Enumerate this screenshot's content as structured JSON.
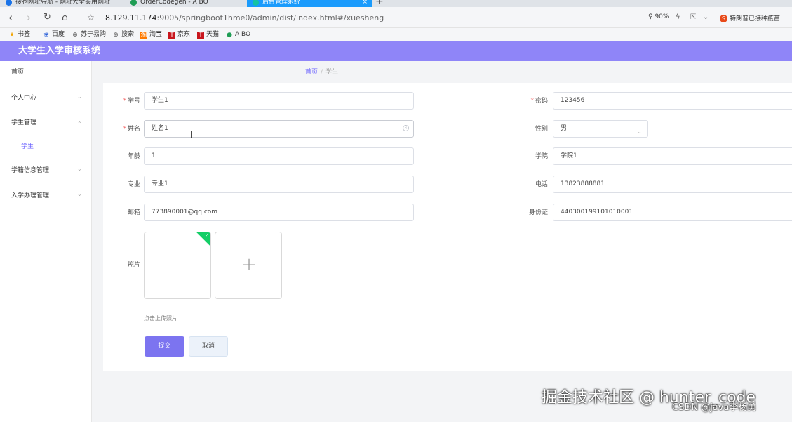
{
  "browser": {
    "tabs": [
      {
        "label": "搜狗网址导航 - 网址大全实用网址",
        "color": "#1a73e8"
      },
      {
        "label": "OrderCodegen - A BO",
        "color": "#1f9d55"
      },
      {
        "label": "后台管理系统",
        "color": "#16c2a3"
      }
    ],
    "new_tab": "+",
    "close": "×",
    "nav": {
      "back": "‹",
      "forward": "›",
      "reload": "↻",
      "home": "⌂",
      "star": "☆"
    },
    "url_host": "8.129.11.174",
    "url_rest": ":9005/springboot1hme0/admin/dist/index.html#/xuesheng",
    "zoom": "90%",
    "news": "特朗普已接种疫苗",
    "news_icon": "S",
    "bookmarks": [
      "书签",
      "百度",
      "苏宁易购",
      "搜索",
      "淘宝",
      "京东",
      "天猫",
      "A BO"
    ]
  },
  "app": {
    "title": "大学生入学审核系统"
  },
  "sidebar": {
    "items": [
      {
        "label": "首页",
        "chevron": ""
      },
      {
        "label": "个人中心",
        "chevron": "⌄"
      },
      {
        "label": "学生管理",
        "chevron": "⌃"
      },
      {
        "label": "学籍信息管理",
        "chevron": "⌄"
      },
      {
        "label": "入学办理管理",
        "chevron": "⌄"
      }
    ],
    "sub_item": "学生"
  },
  "breadcrumb": {
    "home": "首页",
    "separator": "/",
    "current": "学生"
  },
  "form": {
    "required_mark": "*",
    "student_id": {
      "label": "学号",
      "value": "学生1"
    },
    "password": {
      "label": "密码",
      "value": "123456"
    },
    "name": {
      "label": "姓名",
      "value": "姓名1"
    },
    "gender": {
      "label": "性别",
      "value": "男"
    },
    "age": {
      "label": "年龄",
      "value": "1"
    },
    "college": {
      "label": "学院",
      "value": "学院1"
    },
    "major": {
      "label": "专业",
      "value": "专业1"
    },
    "phone": {
      "label": "电话",
      "value": "13823888881"
    },
    "email": {
      "label": "邮箱",
      "value": "773890001@qq.com"
    },
    "id_card": {
      "label": "身份证",
      "value": "440300199101010001"
    },
    "photo": {
      "label": "照片",
      "hint": "点击上传照片"
    },
    "plus": "+",
    "check": "✓",
    "submit": "提交",
    "cancel": "取消"
  },
  "cursor": "I",
  "watermark": {
    "main": "掘金技术社区 @ hunter_code",
    "sub": "CSDN @java李杨勇"
  },
  "colors": {
    "accent": "#8f85f8",
    "primary_button": "#7c74f0",
    "upload_success": "#13ce66",
    "required": "#f56c6c"
  }
}
